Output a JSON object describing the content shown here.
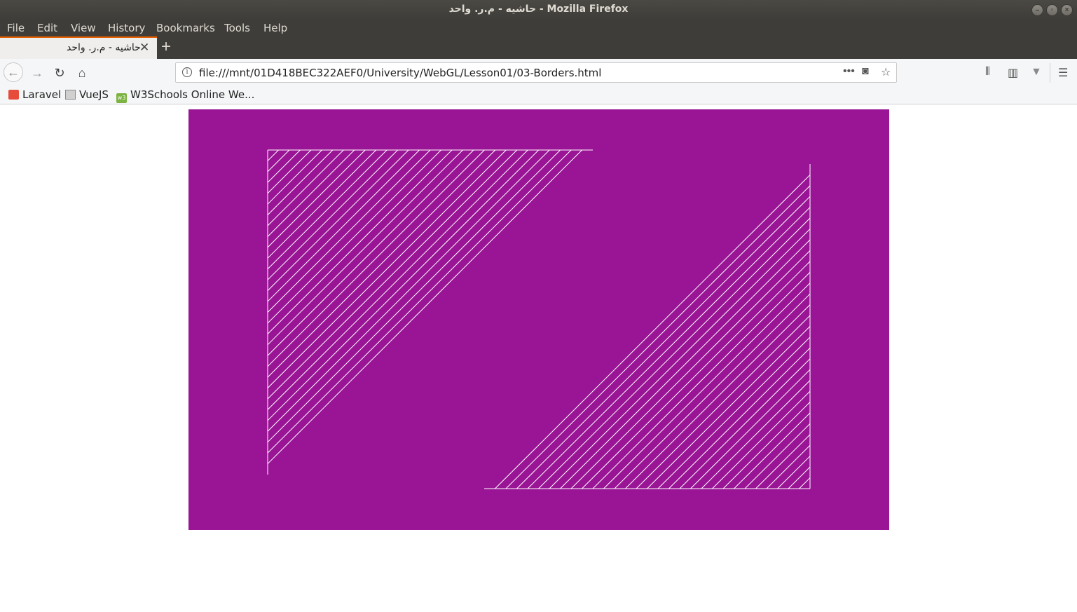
{
  "window": {
    "title": "حاشیه - م.ر. واحد - Mozilla Firefox"
  },
  "menu": [
    "File",
    "Edit",
    "View",
    "History",
    "Bookmarks",
    "Tools",
    "Help"
  ],
  "tab": {
    "title": "حاشیه - م.ر. واحد",
    "close_icon": "close-icon",
    "new_tab_icon": "plus-icon"
  },
  "navbar": {
    "url": "file:///mnt/01D418BEC322AEF0/University/WebGL/Lesson01/03-Borders.html",
    "icons": [
      "back-icon",
      "forward-icon",
      "reload-icon",
      "home-icon",
      "info-icon",
      "more-actions-icon",
      "pocket-icon",
      "bookmark-star-icon",
      "library-icon",
      "sidebar-icon",
      "extension-icon",
      "hamburger-menu-icon"
    ]
  },
  "bookmarks": [
    {
      "label": "Laravel",
      "icon": "laravel-icon"
    },
    {
      "label": "VueJS",
      "icon": "folder-icon"
    },
    {
      "label": "W3Schools Online We...",
      "icon": "w3schools-icon"
    }
  ],
  "canvas": {
    "background": "#991595",
    "stroke": "#ffffff",
    "pattern": "string-art borders in top-left and bottom-right corners"
  }
}
